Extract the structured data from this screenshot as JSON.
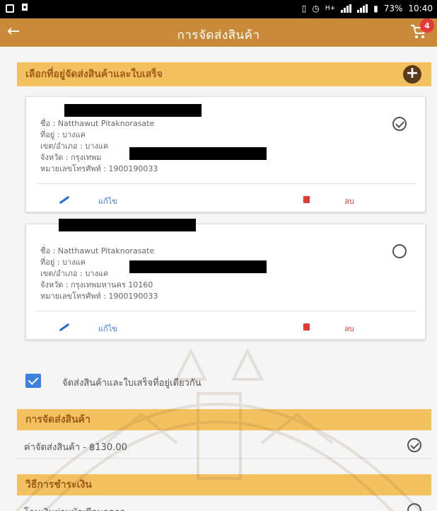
{
  "statusbar": {
    "battery": "73%",
    "time": "10:40",
    "network": "H+"
  },
  "appbar": {
    "title": "การจัดส่งสินค้า",
    "cart_count": "4"
  },
  "address_section": {
    "title": "เลือกที่อยู่จัดส่งสินค้าและใบเสร็จ"
  },
  "addresses": [
    {
      "name": "ชื่อ : Natthawut Pitaknorasate",
      "address": "ที่อยู่ : บางแค",
      "district": "เขต/อำเภอ : บางแค",
      "province": "จังหวัด : กรุงเทพม",
      "phone": "หมายเลขโทรศัพท์ : 1900190033",
      "edit_label": "แก้ไข",
      "delete_label": "ลบ",
      "selected": true
    },
    {
      "name": "ชื่อ : Natthawut Pitaknorasate",
      "address": "ที่อยู่ : บางแค",
      "district": "เขต/อำเภอ : บางแค",
      "province": "จังหวัด : กรุงเทพมหานคร 10160",
      "phone": "หมายเลขโทรศัพท์ : 1900190033",
      "edit_label": "แก้ไข",
      "delete_label": "ลบ",
      "selected": false
    }
  ],
  "same_address": {
    "label": "จัดส่งสินค้าและใบเสร็จที่อยู่เดียวกัน",
    "checked": true
  },
  "shipping_section": {
    "title": "การจัดส่งสินค้า",
    "option_label": "ค่าจัดส่งสินค้า - ฿130.00"
  },
  "payment_section": {
    "title": "วิธีการชำระเงิน",
    "option_label": "โอนเงินผ่านบัญชีธนาคาร"
  },
  "colors": {
    "accent": "#c88a38",
    "section_bg": "#f3c15f",
    "link": "#3b7fd8",
    "delete": "#e53935",
    "checkbox": "#3b82e0"
  }
}
